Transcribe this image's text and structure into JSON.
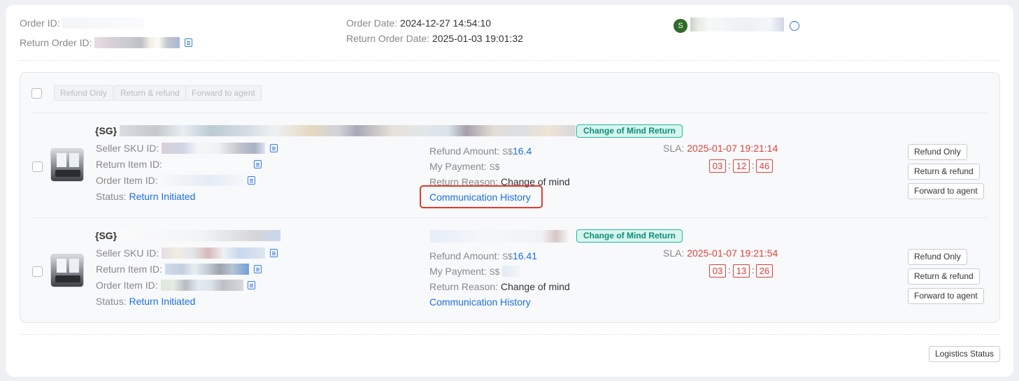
{
  "header": {
    "order_id_label": "Order ID:",
    "return_order_id_label": "Return Order ID:",
    "order_date_label": "Order Date:",
    "order_date_value": "2024-12-27 14:54:10",
    "return_order_date_label": "Return Order Date:",
    "return_order_date_value": "2025-01-03 19:01:32",
    "avatar_initial": "S"
  },
  "bulk_actions": {
    "refund_only": "Refund Only",
    "return_refund": "Return & refund",
    "forward_agent": "Forward to agent"
  },
  "items": [
    {
      "title_prefix": "{SG}",
      "tag": "Change of Mind Return",
      "seller_sku_label": "Seller SKU ID:",
      "return_item_label": "Return Item ID:",
      "order_item_label": "Order Item ID:",
      "status_label": "Status:",
      "status_value": "Return Initiated",
      "refund_amount_label": "Refund Amount:",
      "currency": "S$",
      "refund_amount_value": "16.4",
      "my_payment_label": "My Payment:",
      "return_reason_label": "Return Reason:",
      "return_reason_value": "Change of mind",
      "comm_history": "Communication History",
      "sla_label": "SLA:",
      "sla_value": "2025-01-07 19:21:14",
      "timer": [
        "03",
        "12",
        "46"
      ],
      "btn_refund_only": "Refund Only",
      "btn_return_refund": "Return & refund",
      "btn_forward_agent": "Forward to agent"
    },
    {
      "title_prefix": "{SG}",
      "tag": "Change of Mind Return",
      "seller_sku_label": "Seller SKU ID:",
      "return_item_label": "Return Item ID:",
      "order_item_label": "Order Item ID:",
      "status_label": "Status:",
      "status_value": "Return Initiated",
      "refund_amount_label": "Refund Amount:",
      "currency": "S$",
      "refund_amount_value": "16.41",
      "my_payment_label": "My Payment:",
      "return_reason_label": "Return Reason:",
      "return_reason_value": "Change of mind",
      "comm_history": "Communication History",
      "sla_label": "SLA:",
      "sla_value": "2025-01-07 19:21:54",
      "timer": [
        "03",
        "13",
        "26"
      ],
      "btn_refund_only": "Refund Only",
      "btn_return_refund": "Return & refund",
      "btn_forward_agent": "Forward to agent"
    }
  ],
  "footer": {
    "logistics_status": "Logistics Status"
  },
  "colors": {
    "accent_blue": "#1a6fe0",
    "sla_red": "#e0413a",
    "tag_green": "#23b99c",
    "highlight_red": "#e03a2a"
  }
}
